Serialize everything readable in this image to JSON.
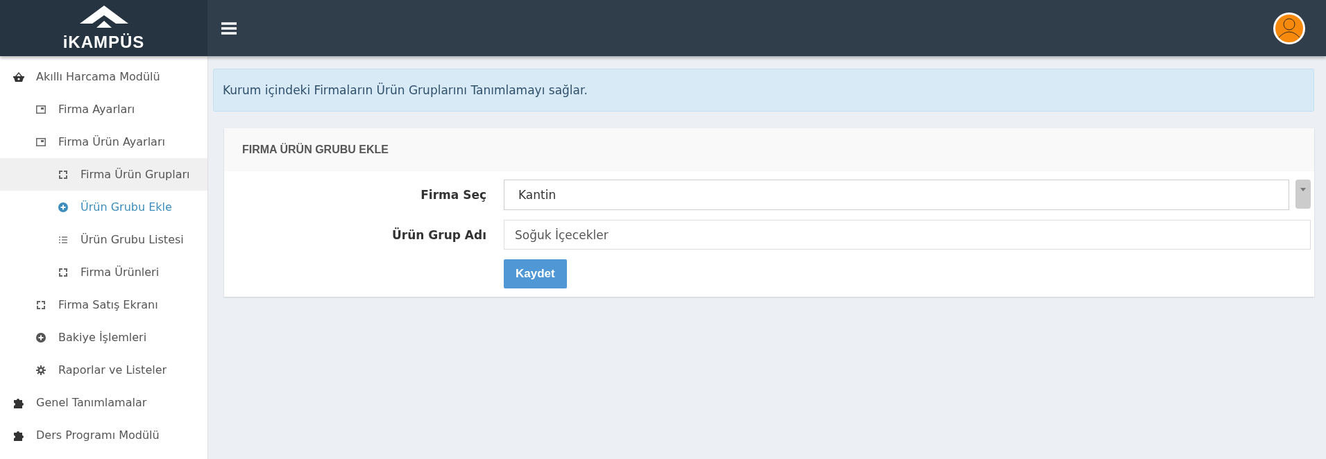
{
  "header": {
    "logo_text": "iKAMPÜS"
  },
  "sidebar": {
    "items": [
      {
        "label": "Akıllı Harcama Modülü",
        "kind": "basket",
        "selected": false,
        "hovered": false,
        "children": [
          {
            "label": "Firma Ayarları",
            "kind": "window",
            "selected": false,
            "hovered": false
          },
          {
            "label": "Firma Ürün Ayarları",
            "kind": "window",
            "selected": false,
            "hovered": false,
            "children": [
              {
                "label": "Firma Ürün Grupları",
                "kind": "expand",
                "selected": false,
                "hovered": true
              },
              {
                "label": "Ürün Grubu Ekle",
                "kind": "plus",
                "selected": true,
                "hovered": false
              },
              {
                "label": "Ürün Grubu Listesi",
                "kind": "list",
                "selected": false,
                "hovered": false
              },
              {
                "label": "Firma Ürünleri",
                "kind": "expand",
                "selected": false,
                "hovered": false
              }
            ]
          },
          {
            "label": "Firma Satış Ekranı",
            "kind": "expand",
            "selected": false,
            "hovered": false
          },
          {
            "label": "Bakiye İşlemleri",
            "kind": "plus",
            "selected": false,
            "hovered": false
          },
          {
            "label": "Raporlar ve Listeler",
            "kind": "gear",
            "selected": false,
            "hovered": false
          }
        ]
      },
      {
        "label": "Genel Tanımlamalar",
        "kind": "puzzle",
        "selected": false,
        "hovered": false
      },
      {
        "label": "Ders Programı Modülü",
        "kind": "puzzle",
        "selected": false,
        "hovered": false
      }
    ]
  },
  "info": "Kurum içindeki Firmaların Ürün Gruplarını Tanımlamayı sağlar.",
  "form": {
    "title": "FIRMA ÜRÜN GRUBU EKLE",
    "fields": [
      {
        "kind": "select",
        "label": "Firma Seç",
        "value": "Kantin"
      },
      {
        "kind": "text",
        "label": "Ürün Grup Adı",
        "value": "Soğuk İçecekler"
      }
    ],
    "button": "Kaydet"
  }
}
